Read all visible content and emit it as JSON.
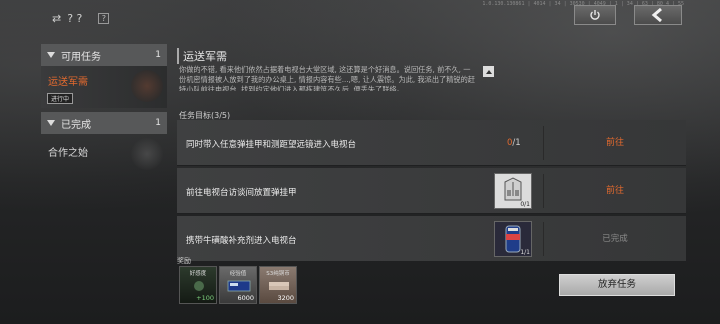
{
  "topbar": {
    "left_icon": "swap-icon",
    "help_text": "? ?",
    "help_box": "?",
    "version": "1.0.130.130861 | 4014 | 34 | 30530 | 4049 | 1 | 34 | 63 | 80  4 | 55",
    "power_icon": "power-icon",
    "back_icon": "chevron-left-icon"
  },
  "left_panel": {
    "available": {
      "label": "可用任务",
      "count": "1"
    },
    "available_tasks": [
      {
        "title": "运送军需",
        "status": "进行中"
      }
    ],
    "completed": {
      "label": "已完成",
      "count": "1"
    },
    "completed_tasks": [
      {
        "title": "合作之始"
      }
    ]
  },
  "quest": {
    "title": "运送军需",
    "description": "你做的不错, 看来他们依然占据着电视台大堂区域, 这还算是个好消息。说回任务, 前不久, 一份机密情报被人放到了我的办公桌上, 情报内容有些...,嗯, 让人震惊。为此, 我派出了精锐的赶特小队前往电视台, 找到约定他们进入那栋建筑不久后, 便丢失了联络。",
    "objectives_label": "任务目标(3/5)",
    "objectives": [
      {
        "text": "同时带入任意弹挂甲和测距望远镜进入电视台",
        "progress_cur": "0",
        "progress_tot": "/1",
        "action": "前往"
      },
      {
        "text": "前往电视台访谈间放置弹挂甲",
        "item_qty": "0/1",
        "action": "前往"
      },
      {
        "text": "携带牛磺酸补充剂进入电视台",
        "item_qty": "1/1",
        "action": "已完成"
      }
    ],
    "rewards_label": "奖励",
    "rewards": [
      {
        "name": "好感度",
        "qty": "+100"
      },
      {
        "name": "经验值",
        "qty": "6000"
      },
      {
        "name": "S3纯铜币",
        "qty": "3200"
      }
    ],
    "abandon_label": "放弃任务"
  },
  "colors": {
    "accent": "#e46a2e",
    "panel": "#3f4041",
    "button": "#cfcfcf"
  }
}
